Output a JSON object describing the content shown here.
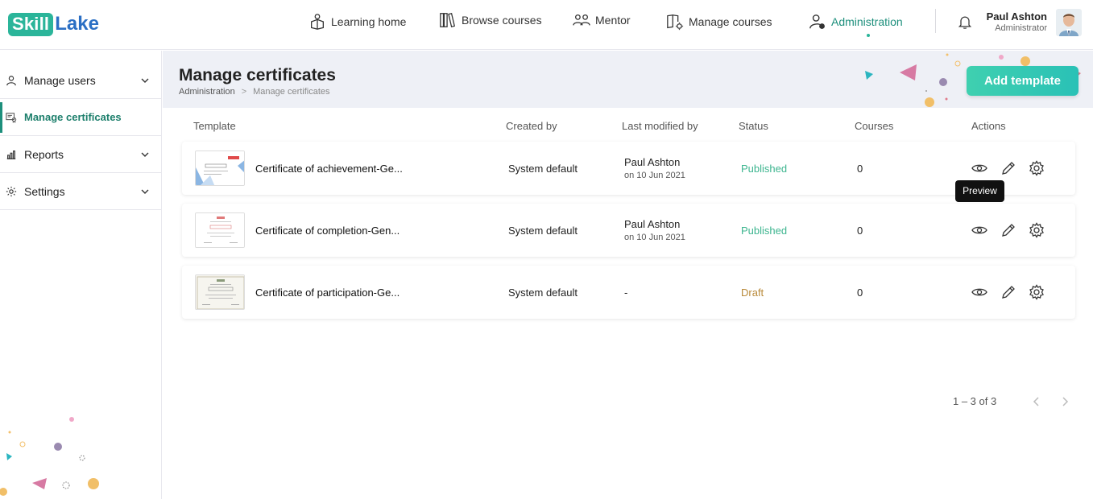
{
  "brand": {
    "part1": "Skill",
    "part2": "Lake"
  },
  "nav": {
    "items": [
      {
        "label": "Learning home",
        "icon": "learning-home-icon"
      },
      {
        "label": "Browse courses",
        "icon": "books-icon"
      },
      {
        "label": "Mentor",
        "icon": "mentor-icon"
      },
      {
        "label": "Manage courses",
        "icon": "manage-courses-icon"
      },
      {
        "label": "Administration",
        "icon": "admin-user-icon",
        "active": true
      }
    ]
  },
  "user": {
    "name": "Paul Ashton",
    "role": "Administrator"
  },
  "sidebar": {
    "items": [
      {
        "label": "Manage users",
        "icon": "user-icon",
        "expandable": true
      },
      {
        "label": "Manage certificates",
        "icon": "certificate-icon",
        "active": true
      },
      {
        "label": "Reports",
        "icon": "reports-icon",
        "expandable": true
      },
      {
        "label": "Settings",
        "icon": "settings-icon",
        "expandable": true
      }
    ]
  },
  "header": {
    "title": "Manage certificates",
    "breadcrumb": {
      "parent": "Administration",
      "separator": ">",
      "current": "Manage certificates"
    },
    "add_button": "Add template"
  },
  "table": {
    "columns": [
      "Template",
      "Created by",
      "Last modified by",
      "Status",
      "Courses",
      "Actions"
    ],
    "rows": [
      {
        "template": "Certificate of achievement-Ge...",
        "created_by": "System default",
        "modified_by": "Paul Ashton",
        "modified_on": "on 10 Jun 2021",
        "status": "Published",
        "courses": "0"
      },
      {
        "template": "Certificate of completion-Gen...",
        "created_by": "System default",
        "modified_by": "Paul Ashton",
        "modified_on": "on 10 Jun 2021",
        "status": "Published",
        "courses": "0"
      },
      {
        "template": "Certificate of participation-Ge...",
        "created_by": "System default",
        "modified_by": "-",
        "modified_on": "",
        "status": "Draft",
        "courses": "0"
      }
    ]
  },
  "tooltip": "Preview",
  "pagination": {
    "range": "1 – 3 of 3"
  },
  "colors": {
    "accent": "#2bb59a",
    "published": "#3db58f",
    "draft": "#b98a3a",
    "brand_blue": "#2b6fc4"
  }
}
